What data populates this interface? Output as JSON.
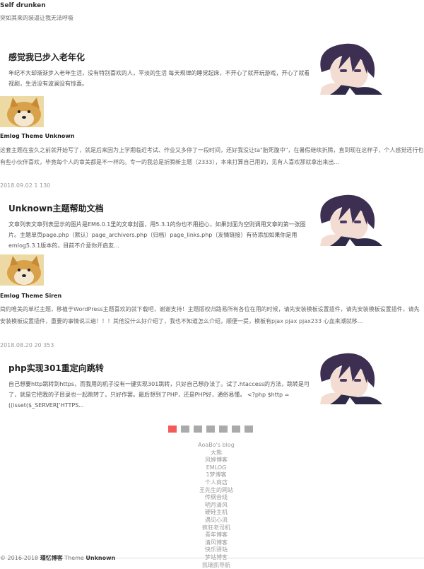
{
  "site": {
    "title": "Self drunken",
    "desc": "突如其来的装逼让我无法呼吸"
  },
  "features": [
    {
      "title": "感觉我已步入老年化",
      "body": "年纪不大却渐渐步入老年生活，没有特别喜欢的人，平淡的生活 每天规律的睡觉起床，不开心了就开玩游戏，开心了就看电视剧，生活没有波澜没有惊喜。"
    },
    {
      "title": "Unknown主题帮助文档",
      "body": "文章列表文章列表显示的图片是EM6.0.1里的文章封面，用5.3.1的你也不用担心，如果封面为空则调用文章的第一张图片。主题单页page.php（默认）page_archivers.php（归档）page_links.php（友情链接）有待添加如果你是用emlog5.3.1版本的，目前不介意你开启友..."
    },
    {
      "title": "php实现301重定向跳转",
      "body": "自己想要http跳转到https，而我用的机子没有一键实现301跳转，只好自己想办法了。试了.htaccess的方法，跳转是可以了，就是它把我的子目录也一起跳转了，只好作罢。最后想到了PHP，还是PHP好，通俗易懂。 <?php $http = ((isset($_SERVER['HTTPS..."
    }
  ],
  "entries": [
    {
      "title": "Emlog Theme Unknown",
      "body": "这套主题在蛮久之前就开始写了，就是后来因为上学期临近考试、作业又多停了一段时间，还好我没让ta\"胎死腹中\"，在暑假继续折腾，直到现在这样子，个人感觉还行也有些小伙伴喜欢，毕竟每个人的审美都是不一样的。专一的我总是折腾新主题（2333），本来打算自己用的，见有人喜欢那就拿出来出...",
      "meta": "2018.09.02 1 130"
    },
    {
      "title": "Emlog Theme Siren",
      "body": "简约唯美的单栏主题，移植于WordPress主题喜欢的就下载吧，谢谢支持！主题版权归路易所有各位在用的时候，请先安装模板设置插件，请先安装模板设置插件，请先安装模板设置插件，重要的事情说三遍！！！其他没什么好介绍了，我也不知道怎么介绍，顺便一提，模板有pjax pjax pjax233 心血来潮就移...",
      "meta": "2018.08.20 20 353"
    }
  ],
  "pager": {
    "pages": 7,
    "current": 1
  },
  "links": [
    "AoaBo's blog",
    "大熊",
    "风婷博客",
    "EMLOG",
    "1梦博客",
    "个人商店",
    "王先生的网站",
    "传纲音线",
    "明月清风",
    "硬硅主机",
    "遇见心流",
    "疯狂老司机",
    "青年博客",
    "清风博客",
    "快乐驿站",
    "梦站博客",
    "凯瑞凯导航"
  ],
  "footer": {
    "copy": "© 2016-2018 ",
    "brand": "瑾忆博客",
    "theme_label": " Theme ",
    "theme_name": "Unknown"
  }
}
